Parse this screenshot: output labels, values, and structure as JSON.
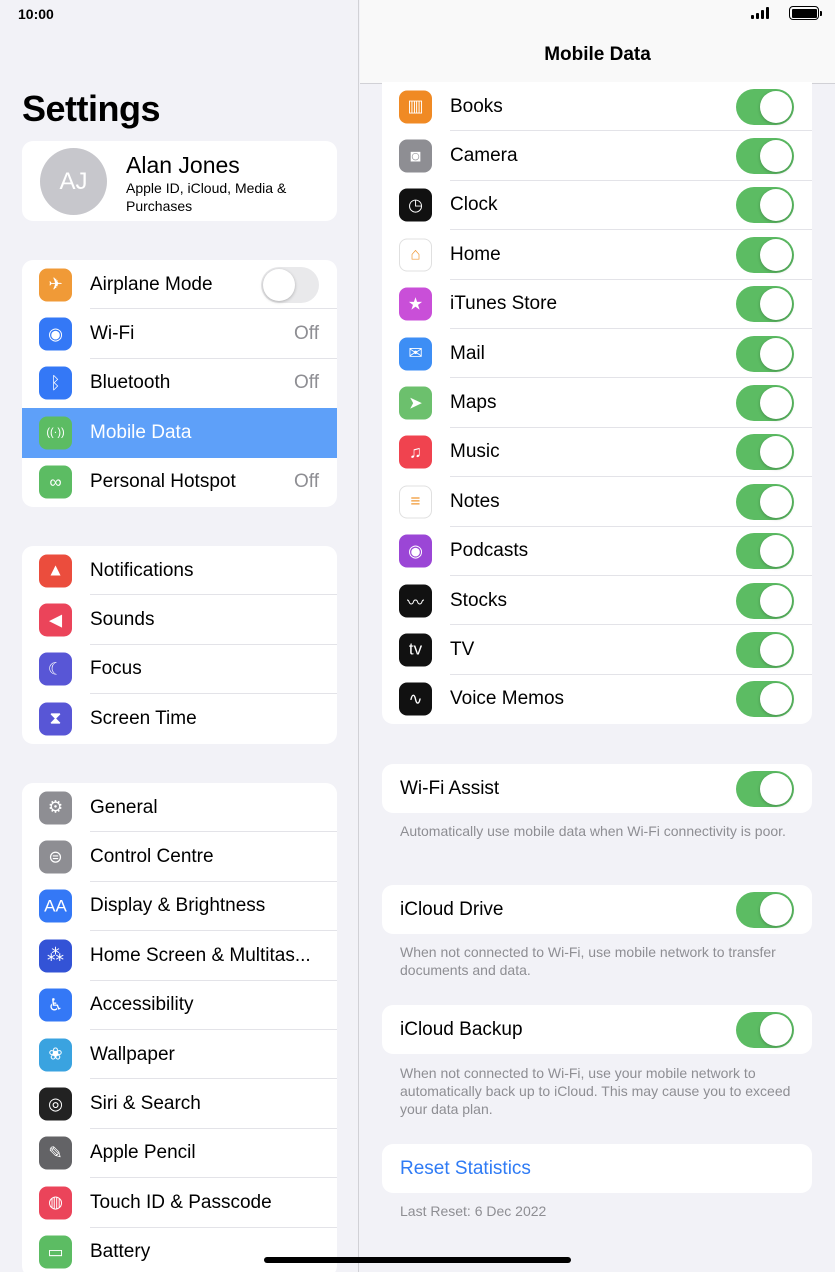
{
  "status": {
    "time": "10:00"
  },
  "sidebar": {
    "title": "Settings",
    "profile": {
      "initials": "AJ",
      "name": "Alan Jones",
      "subtitle": "Apple ID, iCloud, Media & Purchases"
    },
    "group1": [
      {
        "label": "Airplane Mode",
        "icon": "airplane-icon",
        "color": "#f09a37",
        "glyph": "✈",
        "toggle": false
      },
      {
        "label": "Wi-Fi",
        "icon": "wifi-icon",
        "color": "#3478f6",
        "glyph": "◉",
        "value": "Off"
      },
      {
        "label": "Bluetooth",
        "icon": "bluetooth-icon",
        "color": "#3478f6",
        "glyph": "ᛒ",
        "value": "Off"
      },
      {
        "label": "Mobile Data",
        "icon": "antenna-icon",
        "color": "#5cbc63",
        "glyph": "((·))",
        "selected": true
      },
      {
        "label": "Personal Hotspot",
        "icon": "hotspot-icon",
        "color": "#5cbc63",
        "glyph": "∞",
        "value": "Off"
      }
    ],
    "group2": [
      {
        "label": "Notifications",
        "icon": "bell-icon",
        "color": "#eb4d3d",
        "glyph": "▲"
      },
      {
        "label": "Sounds",
        "icon": "speaker-icon",
        "color": "#eb445a",
        "glyph": "◀"
      },
      {
        "label": "Focus",
        "icon": "moon-icon",
        "color": "#5856d6",
        "glyph": "☾"
      },
      {
        "label": "Screen Time",
        "icon": "hourglass-icon",
        "color": "#5856d6",
        "glyph": "⧗"
      }
    ],
    "group3": [
      {
        "label": "General",
        "icon": "gear-icon",
        "color": "#8e8e93",
        "glyph": "⚙"
      },
      {
        "label": "Control Centre",
        "icon": "control-centre-icon",
        "color": "#8e8e93",
        "glyph": "⊜"
      },
      {
        "label": "Display & Brightness",
        "icon": "display-icon",
        "color": "#3478f6",
        "glyph": "AA"
      },
      {
        "label": "Home Screen & Multitas...",
        "icon": "home-screen-icon",
        "color": "#3353d6",
        "glyph": "⁂"
      },
      {
        "label": "Accessibility",
        "icon": "accessibility-icon",
        "color": "#3478f6",
        "glyph": "♿"
      },
      {
        "label": "Wallpaper",
        "icon": "wallpaper-icon",
        "color": "#3aa3e0",
        "glyph": "❀"
      },
      {
        "label": "Siri & Search",
        "icon": "siri-icon",
        "color": "#222222",
        "glyph": "◎"
      },
      {
        "label": "Apple Pencil",
        "icon": "pencil-icon",
        "color": "#636366",
        "glyph": "✎"
      },
      {
        "label": "Touch ID & Passcode",
        "icon": "fingerprint-icon",
        "color": "#eb445a",
        "glyph": "◍"
      },
      {
        "label": "Battery",
        "icon": "battery-icon",
        "color": "#5cbc63",
        "glyph": "▭"
      }
    ]
  },
  "detail": {
    "title": "Mobile Data",
    "apps": [
      {
        "label": "Books",
        "icon": "books-icon",
        "color": "#f08a24",
        "glyph": "▥",
        "on": true
      },
      {
        "label": "Camera",
        "icon": "camera-icon",
        "color": "#8e8e93",
        "glyph": "◙",
        "on": true
      },
      {
        "label": "Clock",
        "icon": "clock-icon",
        "color": "#111111",
        "glyph": "◷",
        "on": true
      },
      {
        "label": "Home",
        "icon": "home-icon",
        "color": "#ffffff",
        "glyph": "⌂",
        "on": true
      },
      {
        "label": "iTunes Store",
        "icon": "star-icon",
        "color": "#c94fd8",
        "glyph": "★",
        "on": true
      },
      {
        "label": "Mail",
        "icon": "mail-icon",
        "color": "#3d8ef5",
        "glyph": "✉",
        "on": true
      },
      {
        "label": "Maps",
        "icon": "maps-icon",
        "color": "#6cc06d",
        "glyph": "➤",
        "on": true
      },
      {
        "label": "Music",
        "icon": "music-icon",
        "color": "#f0434f",
        "glyph": "♫",
        "on": true
      },
      {
        "label": "Notes",
        "icon": "notes-icon",
        "color": "#ffffff",
        "glyph": "≡",
        "on": true
      },
      {
        "label": "Podcasts",
        "icon": "podcasts-icon",
        "color": "#9b46d6",
        "glyph": "◉",
        "on": true
      },
      {
        "label": "Stocks",
        "icon": "stocks-icon",
        "color": "#111111",
        "glyph": "〰",
        "on": true
      },
      {
        "label": "TV",
        "icon": "tv-icon",
        "color": "#111111",
        "glyph": "tv",
        "on": true
      },
      {
        "label": "Voice Memos",
        "icon": "voice-memos-icon",
        "color": "#111111",
        "glyph": "∿",
        "on": true
      }
    ],
    "wifi_assist": {
      "label": "Wi-Fi Assist",
      "on": true,
      "note": "Automatically use mobile data when Wi-Fi connectivity is poor."
    },
    "icloud_drive": {
      "label": "iCloud Drive",
      "on": true,
      "note": "When not connected to Wi-Fi, use mobile network to transfer documents and data."
    },
    "icloud_backup": {
      "label": "iCloud Backup",
      "on": true,
      "note": "When not connected to Wi-Fi, use your mobile network to automatically back up to iCloud. This may cause you to exceed your data plan."
    },
    "reset": {
      "label": "Reset Statistics",
      "note": "Last Reset: 6 Dec 2022"
    }
  }
}
